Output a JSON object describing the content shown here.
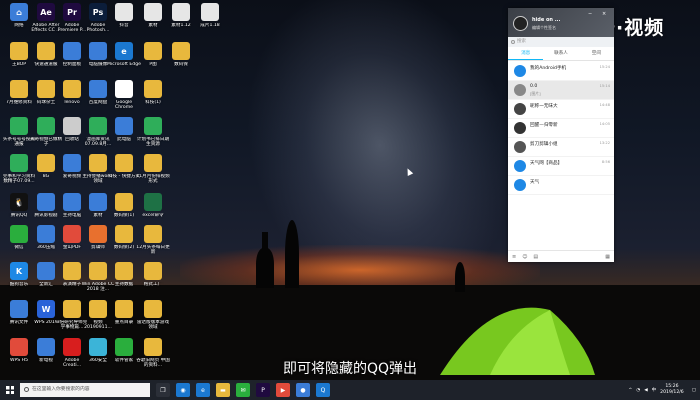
{
  "watermark": "天奇·视频",
  "subtitle": "即可将隐藏的QQ弹出",
  "desktop_icons": [
    {
      "label": "网络",
      "color": "#3b7dd8",
      "glyph": "⌂"
    },
    {
      "label": "Adobe After Effects CC ...",
      "color": "#1f0a3f",
      "glyph": "Ae"
    },
    {
      "label": "Adobe Premiere P...",
      "color": "#1f0a3f",
      "glyph": "Pr"
    },
    {
      "label": "Adobe Photosh...",
      "color": "#0b1d3a",
      "glyph": "Ps"
    },
    {
      "label": "抖音",
      "color": "#e6e6e6",
      "glyph": ""
    },
    {
      "label": "素材",
      "color": "#e6e6e6",
      "glyph": ""
    },
    {
      "label": "素材1.12",
      "color": "#e6e6e6",
      "glyph": ""
    },
    {
      "label": "成片1.18",
      "color": "#e6e6e6",
      "glyph": ""
    },
    {
      "label": "王BOP",
      "color": "#e8b83d",
      "glyph": ""
    },
    {
      "label": "快速通道服",
      "color": "#e8b83d",
      "glyph": ""
    },
    {
      "label": "控制面板",
      "color": "#3b7dd8",
      "glyph": ""
    },
    {
      "label": "电脑摄像",
      "color": "#3b7dd8",
      "glyph": ""
    },
    {
      "label": "Microsoft Edge",
      "color": "#1b78d0",
      "glyph": "e"
    },
    {
      "label": "P图",
      "color": "#e8b83d",
      "glyph": ""
    },
    {
      "label": "数码保",
      "color": "#e8b83d",
      "glyph": ""
    },
    {
      "label": "7月维修资料",
      "color": "#e8b83d",
      "glyph": ""
    },
    {
      "label": "码球杂土",
      "color": "#e8b83d",
      "glyph": ""
    },
    {
      "label": "lenovo",
      "color": "#e8b83d",
      "glyph": ""
    },
    {
      "label": "百度网盘",
      "color": "#3b7dd8",
      "glyph": ""
    },
    {
      "label": "Google Chrome",
      "color": "#ffffff",
      "glyph": "◉"
    },
    {
      "label": "科技(1)",
      "color": "#e8b83d",
      "glyph": ""
    },
    {
      "label": "头条号号号投稿通报",
      "color": "#2fae5a",
      "glyph": ""
    },
    {
      "label": "天奇视频已做精子",
      "color": "#2fae5a",
      "glyph": ""
    },
    {
      "label": "回收站",
      "color": "#cccccc",
      "glyph": ""
    },
    {
      "label": "漫画库资讯 07.09.8月...",
      "color": "#2fae5a",
      "glyph": ""
    },
    {
      "label": "此电脑",
      "color": "#3b7dd8",
      "glyph": ""
    },
    {
      "label": "计划书已排日期生资源",
      "color": "#2fae5a",
      "glyph": ""
    },
    {
      "label": "完事和学习资料数精子07.09...",
      "color": "#2fae5a",
      "glyph": ""
    },
    {
      "label": "8G",
      "color": "#e8b83d",
      "glyph": ""
    },
    {
      "label": "爱奇视频",
      "color": "#3b7dd8",
      "glyph": ""
    },
    {
      "label": "主持会播word-领域",
      "color": "#e8b83d",
      "glyph": ""
    },
    {
      "label": "科技 - 快捷方式",
      "color": "#e8b83d",
      "glyph": ""
    },
    {
      "label": "11月月份排视频形式",
      "color": "#e8b83d",
      "glyph": ""
    },
    {
      "label": "腾讯QQ",
      "color": "#111111",
      "glyph": "🐧"
    },
    {
      "label": "腾讯影视剧",
      "color": "#3b7dd8",
      "glyph": ""
    },
    {
      "label": "主持电脑",
      "color": "#3b7dd8",
      "glyph": ""
    },
    {
      "label": "素材",
      "color": "#3b7dd8",
      "glyph": ""
    },
    {
      "label": "数码保(1)",
      "color": "#e8b83d",
      "glyph": ""
    },
    {
      "label": "excel命令",
      "color": "#1e7145",
      "glyph": ""
    },
    {
      "label": "微信",
      "color": "#2aae3d",
      "glyph": ""
    },
    {
      "label": "360压缩",
      "color": "#3b7dd8",
      "glyph": ""
    },
    {
      "label": "金山PDF",
      "color": "#e14b3b",
      "glyph": ""
    },
    {
      "label": "剪辑师",
      "color": "#e8702e",
      "glyph": ""
    },
    {
      "label": "数码保(2)",
      "color": "#e8b83d",
      "glyph": ""
    },
    {
      "label": "12月头条每日更新",
      "color": "#e8b83d",
      "glyph": ""
    },
    {
      "label": "酷狗音乐",
      "color": "#1e88e5",
      "glyph": "K"
    },
    {
      "label": "全新汇",
      "color": "#3b7dd8",
      "glyph": ""
    },
    {
      "label": "表演精子",
      "color": "#e8b83d",
      "glyph": ""
    },
    {
      "label": "Win Adobe CC 2018 注...",
      "color": "#e8b83d",
      "glyph": ""
    },
    {
      "label": "主持数据",
      "color": "#e8b83d",
      "glyph": ""
    },
    {
      "label": "格式工厂",
      "color": "#e8b83d",
      "glyph": ""
    },
    {
      "label": "腾讯文件",
      "color": "#3b7dd8",
      "glyph": ""
    },
    {
      "label": "WPS 2019",
      "color": "#2a63d8",
      "glyph": "W"
    },
    {
      "label": "3倍研究导师完学事物篇...",
      "color": "#e8b83d",
      "glyph": ""
    },
    {
      "label": "视频 20190911...",
      "color": "#e8b83d",
      "glyph": ""
    },
    {
      "label": "重点目录",
      "color": "#e8b83d",
      "glyph": ""
    },
    {
      "label": "雷达版版本游戏领域",
      "color": "#e8b83d",
      "glyph": ""
    },
    {
      "label": "WPS H5",
      "color": "#e14b3b",
      "glyph": ""
    },
    {
      "label": "新电视",
      "color": "#3b7dd8",
      "glyph": ""
    },
    {
      "label": "Adobe Creati...",
      "color": "#d81e1e",
      "glyph": ""
    },
    {
      "label": "360安全",
      "color": "#3bb4d8",
      "glyph": ""
    },
    {
      "label": "软件管家",
      "color": "#2aae3d",
      "glyph": ""
    },
    {
      "label": "谷歌旧网页 中国的资料...",
      "color": "#e8b83d",
      "glyph": ""
    }
  ],
  "qq": {
    "user_name": "hide on ...",
    "signature": "编辑个性签名",
    "search_placeholder": "搜索",
    "tabs": [
      "消息",
      "联系人",
      "空间"
    ],
    "conversations": [
      {
        "name": "我的Android手机",
        "msg": "",
        "time": "15:24",
        "color": "#1e88e5"
      },
      {
        "name": "0.0",
        "msg": "[图片]",
        "time": "15:14",
        "color": "#888888"
      },
      {
        "name": "昵称一无味大",
        "msg": "",
        "time": "14:48",
        "color": "#444444"
      },
      {
        "name": "回醒—归零新",
        "msg": "",
        "time": "14:05",
        "color": "#333333"
      },
      {
        "name": "剪刀剪辑小组",
        "msg": "",
        "time": "13:22",
        "color": "#555555"
      },
      {
        "name": "天气网【商品】",
        "msg": "",
        "time": "8:56",
        "color": "#1e88e5"
      },
      {
        "name": "天气",
        "msg": "",
        "time": "",
        "color": "#1e88e5"
      }
    ]
  },
  "taskbar": {
    "search_placeholder": "在这里输入你要搜索的内容",
    "date": "2019/12/6",
    "time": "15:26"
  }
}
